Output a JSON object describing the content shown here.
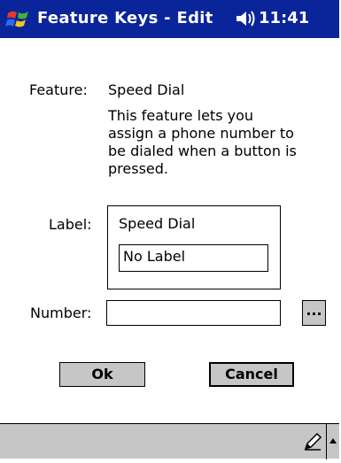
{
  "titlebar": {
    "title": "Feature Keys - Edit",
    "time": "11:41",
    "start_icon": "windows-flag-icon",
    "volume_icon": "speaker-icon",
    "color": "#0a2499"
  },
  "form": {
    "feature_label": "Feature:",
    "feature_value": "Speed Dial",
    "description": "This feature lets you assign a phone number to be dialed when a button is pressed.",
    "label_label": "Label:",
    "label_group_title": "Speed Dial",
    "label_input_value": "No Label",
    "number_label": "Number:",
    "number_input_value": "",
    "browse_button": "...",
    "ok_button": "Ok",
    "cancel_button": "Cancel"
  },
  "sip_bar": {
    "pen_icon": "pen-icon",
    "arrow_icon": "up-arrow-icon"
  }
}
